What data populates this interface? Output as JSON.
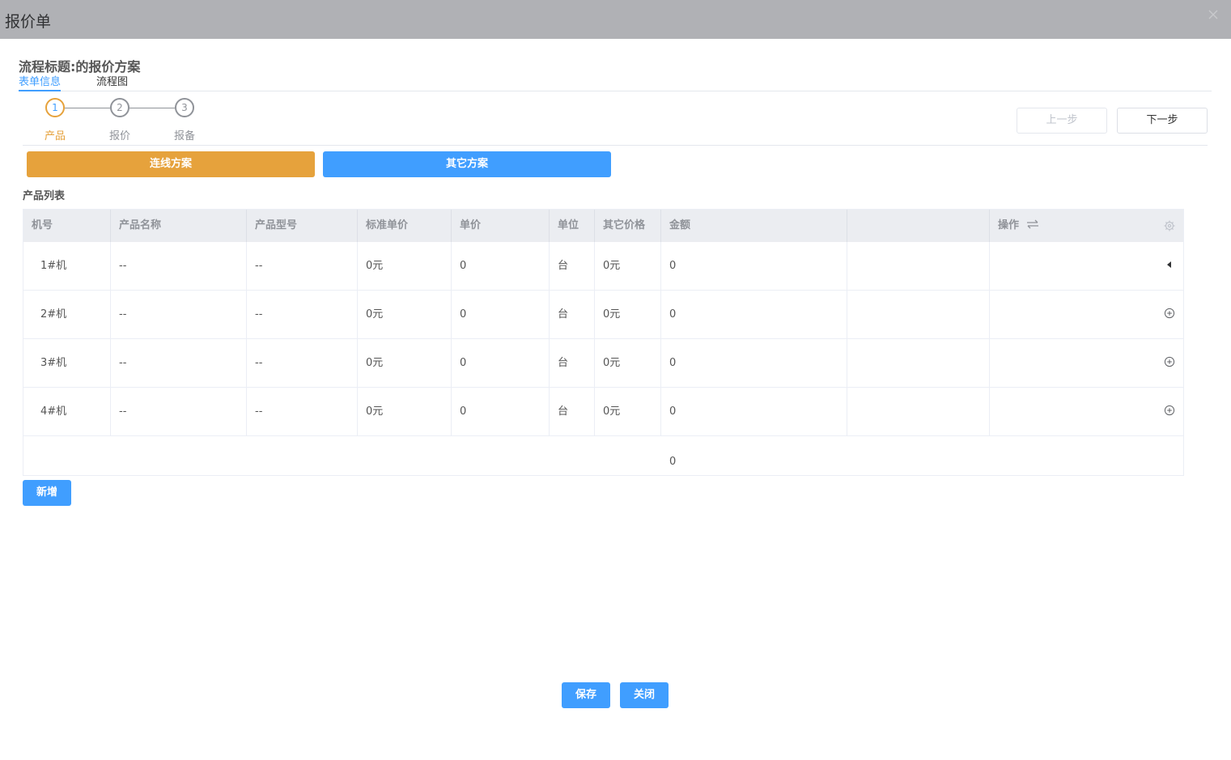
{
  "window": {
    "title": "报价单"
  },
  "header": {
    "process_title": "流程标题:的报价方案"
  },
  "tabs": [
    {
      "label": "表单信息",
      "active": true
    },
    {
      "label": "流程图",
      "active": false
    }
  ],
  "steps": [
    {
      "number": "1",
      "label": "产品",
      "active": true
    },
    {
      "number": "2",
      "label": "报价",
      "active": false
    },
    {
      "number": "3",
      "label": "报备",
      "active": false
    }
  ],
  "step_buttons": {
    "prev": "上一步",
    "next": "下一步"
  },
  "plans": [
    {
      "label": "连线方案",
      "color": "#e6a23c"
    },
    {
      "label": "其它方案",
      "color": "#409eff"
    }
  ],
  "product_list": {
    "label": "产品列表",
    "columns": [
      "机号",
      "产品名称",
      "产品型号",
      "标准单价",
      "单价",
      "单位",
      "其它价格",
      "金额",
      "",
      "操作"
    ],
    "rows": [
      {
        "machine": "1#机",
        "name": "--",
        "model": "--",
        "std_price": "0元",
        "price": "0",
        "unit": "台",
        "other_price": "0元",
        "amount": "0",
        "extra": "",
        "action_icon": "caret-left-icon"
      },
      {
        "machine": "2#机",
        "name": "--",
        "model": "--",
        "std_price": "0元",
        "price": "0",
        "unit": "台",
        "other_price": "0元",
        "amount": "0",
        "extra": "",
        "action_icon": "circle-plus-icon"
      },
      {
        "machine": "3#机",
        "name": "--",
        "model": "--",
        "std_price": "0元",
        "price": "0",
        "unit": "台",
        "other_price": "0元",
        "amount": "0",
        "extra": "",
        "action_icon": "circle-plus-icon"
      },
      {
        "machine": "4#机",
        "name": "--",
        "model": "--",
        "std_price": "0元",
        "price": "0",
        "unit": "台",
        "other_price": "0元",
        "amount": "0",
        "extra": "",
        "action_icon": "circle-plus-icon"
      }
    ],
    "total": "0"
  },
  "buttons": {
    "add": "新增",
    "save": "保存",
    "close": "关闭"
  },
  "colors": {
    "primary": "#409eff",
    "warning": "#e6a23c",
    "titlebar": "#b0b1b5"
  }
}
